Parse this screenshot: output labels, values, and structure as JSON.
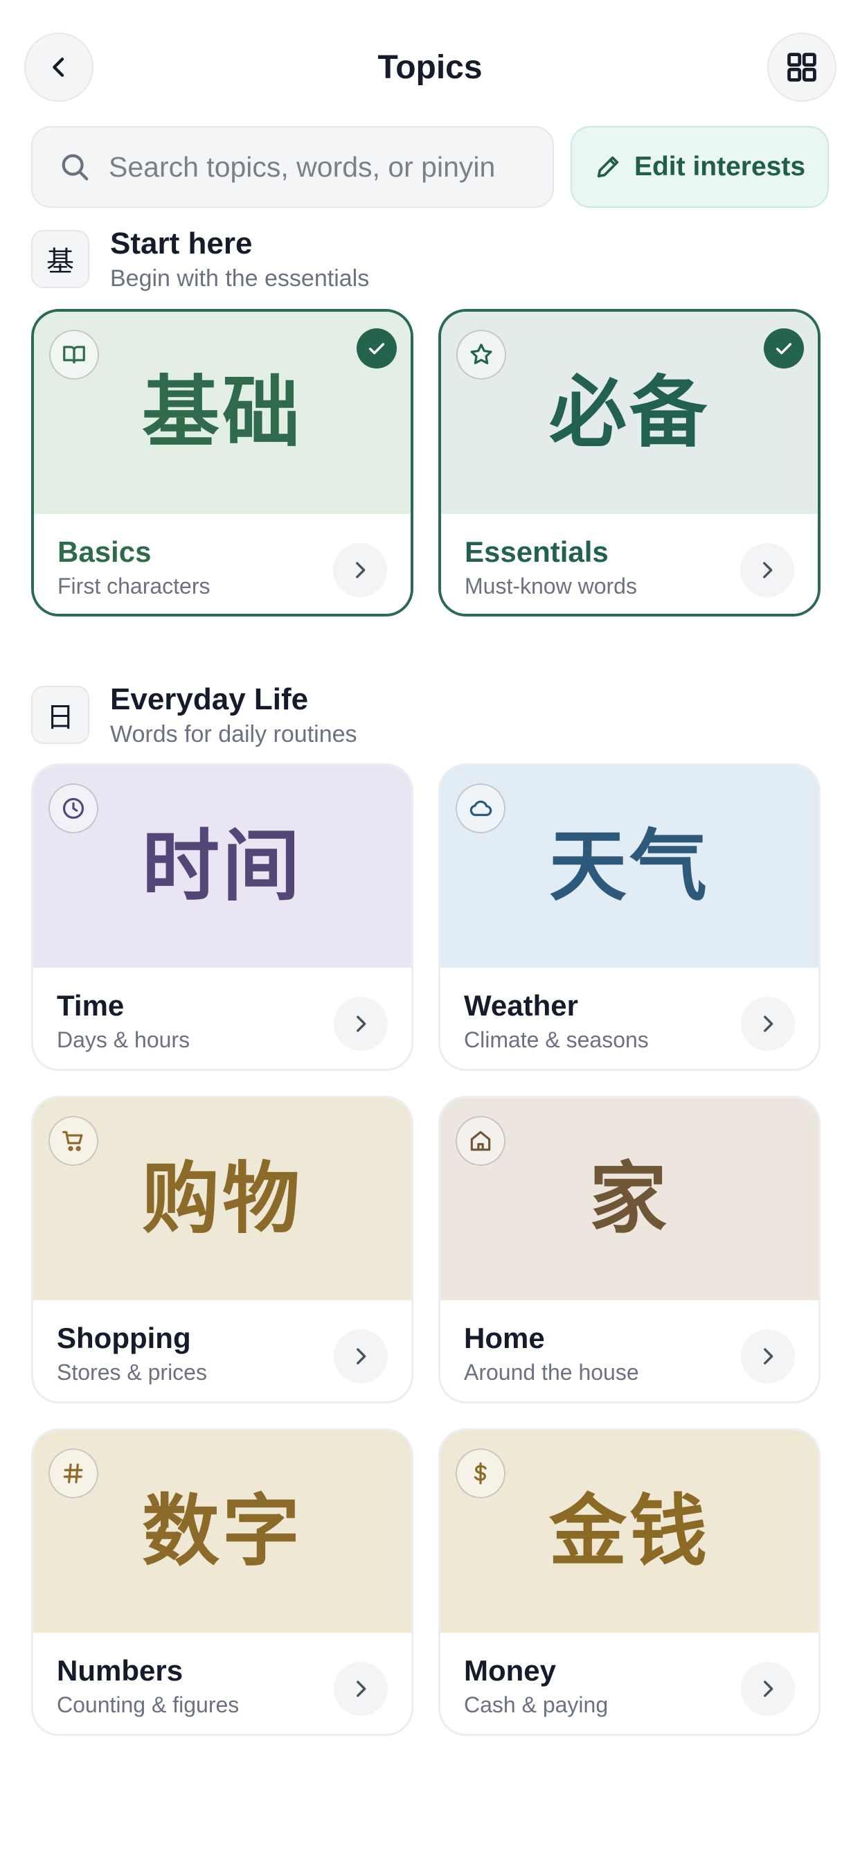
{
  "header": {
    "title": "Topics",
    "back_icon": "chevron-left-icon",
    "grid_icon": "grid-icon"
  },
  "search": {
    "placeholder": "Search topics, words, or pinyin"
  },
  "edit_interests": {
    "label": "Edit interests",
    "icon": "pencil-icon"
  },
  "sections": [
    {
      "icon_char": "基",
      "title": "Start here",
      "subtitle": "Begin with the essentials",
      "cards": [
        {
          "hanzi": "基础",
          "name": "Basics",
          "desc": "First characters",
          "icon": "book-icon",
          "selected": true,
          "bg": "#e3eee5",
          "color": "#2f6b4a"
        },
        {
          "hanzi": "必备",
          "name": "Essentials",
          "desc": "Must-know words",
          "icon": "star-icon",
          "selected": true,
          "bg": "#e3ecea",
          "color": "#22614f"
        }
      ]
    },
    {
      "icon_char": "日",
      "title": "Everyday Life",
      "subtitle": "Words for daily routines",
      "cards": [
        {
          "hanzi": "时间",
          "name": "Time",
          "desc": "Days & hours",
          "icon": "clock-icon",
          "selected": false,
          "bg": "#e9e5f2",
          "color": "#544777"
        },
        {
          "hanzi": "天气",
          "name": "Weather",
          "desc": "Climate & seasons",
          "icon": "cloud-icon",
          "selected": false,
          "bg": "#e2ecf5",
          "color": "#2d5a7b"
        },
        {
          "hanzi": "购物",
          "name": "Shopping",
          "desc": "Stores & prices",
          "icon": "cart-icon",
          "selected": false,
          "bg": "#eee8d6",
          "color": "#8c6b2a"
        },
        {
          "hanzi": "家",
          "name": "Home",
          "desc": "Around the house",
          "icon": "house-icon",
          "selected": false,
          "bg": "#ece6df",
          "color": "#6e5636"
        },
        {
          "hanzi": "数字",
          "name": "Numbers",
          "desc": "Counting & figures",
          "icon": "hash-icon",
          "selected": false,
          "bg": "#eee8d5",
          "color": "#8c6b2a"
        },
        {
          "hanzi": "金钱",
          "name": "Money",
          "desc": "Cash & paying",
          "icon": "dollar-icon",
          "selected": false,
          "bg": "#eee8d4",
          "color": "#8a6a24"
        }
      ]
    }
  ]
}
